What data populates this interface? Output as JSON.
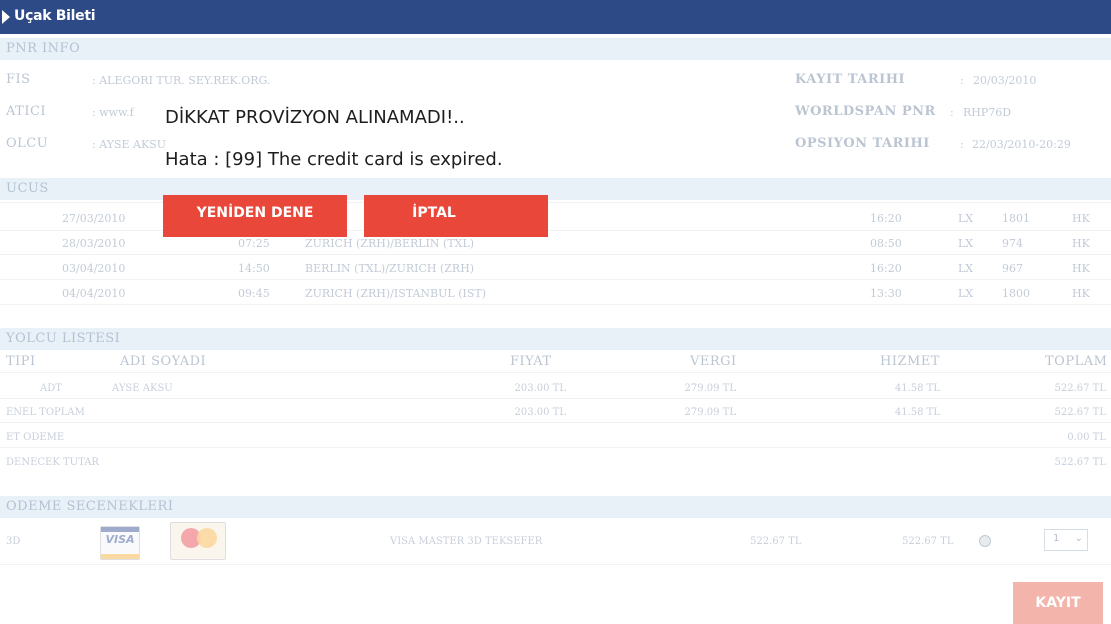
{
  "window": {
    "title": "Uçak Bileti"
  },
  "pnr_info": {
    "heading": "PNR INFO",
    "rows": [
      {
        "label": "FIS",
        "value": ": ALEGORI TUR. SEY.REK.ORG."
      },
      {
        "label": "ATICI",
        "value": ": www.f"
      },
      {
        "label": "OLCU",
        "value": ": AYSE AKSU"
      }
    ],
    "right": [
      {
        "label": "KAYIT TARIHI",
        "sep": ":",
        "value": "20/03/2010"
      },
      {
        "label": "WORLDSPAN PNR",
        "sep": ":",
        "value": "RHP76D"
      },
      {
        "label": "OPSIYON TARIHI",
        "sep": ":",
        "value": "22/03/2010-20:29"
      }
    ]
  },
  "flights": {
    "heading": "UCUS",
    "rows": [
      {
        "date": "27/03/2010",
        "time": "",
        "route": "",
        "arr": "16:20",
        "airline": "LX",
        "no": "1801",
        "status": "HK"
      },
      {
        "date": "28/03/2010",
        "time": "07:25",
        "route": "ZURICH (ZRH)/BERLIN (TXL)",
        "arr": "08:50",
        "airline": "LX",
        "no": "974",
        "status": "HK"
      },
      {
        "date": "03/04/2010",
        "time": "14:50",
        "route": "BERLIN (TXL)/ZURICH (ZRH)",
        "arr": "16:20",
        "airline": "LX",
        "no": "967",
        "status": "HK"
      },
      {
        "date": "04/04/2010",
        "time": "09:45",
        "route": "ZURICH (ZRH)/ISTANBUL (IST)",
        "arr": "13:30",
        "airline": "LX",
        "no": "1800",
        "status": "HK"
      }
    ]
  },
  "passengers": {
    "heading": "YOLCU LISTESI",
    "headers": {
      "type": "TIPI",
      "name": "ADI SOYADI",
      "price": "FIYAT",
      "tax": "VERGI",
      "service": "HIZMET",
      "total": "TOPLAM"
    },
    "row": {
      "type": "ADT",
      "name": "AYSE AKSU",
      "price": "203.00 TL",
      "tax": "279.09 TL",
      "service": "41.58 TL",
      "total": "522.67 TL"
    },
    "genel_toplam": {
      "label": "ENEL TOPLAM",
      "price": "203.00 TL",
      "tax": "279.09 TL",
      "service": "41.58 TL",
      "total": "522.67 TL"
    },
    "net_odeme": {
      "label": "ET ODEME",
      "total": "0.00 TL"
    },
    "odenecek": {
      "label": "DENECEK TUTAR",
      "total": "522.67 TL"
    }
  },
  "payment": {
    "heading": "ODEME SECENEKLERI",
    "option": {
      "code": "3D",
      "visa_text": "VISA",
      "name": "VISA MASTER 3D TEKSEFER",
      "amount1": "522.67 TL",
      "amount2": "522.67 TL",
      "installment": "1"
    }
  },
  "actions": {
    "save": "KAYIT"
  },
  "dialog": {
    "title": "DİKKAT PROVİZYON ALINAMADI!..",
    "message": "Hata : [99] The credit card is expired.",
    "retry": "YENİDEN DENE",
    "cancel": "İPTAL"
  },
  "colors": {
    "titlebar": "#2e4a86",
    "section_bg": "#c9ddef",
    "dialog_button": "#e8473a"
  }
}
